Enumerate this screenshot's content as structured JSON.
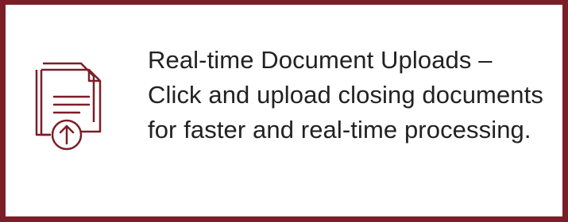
{
  "feature": {
    "description": "Real-time Document Uploads – Click and upload closing documents for faster and real-time processing.",
    "icon": "document-upload-icon",
    "accent_color": "#7b1e28"
  }
}
